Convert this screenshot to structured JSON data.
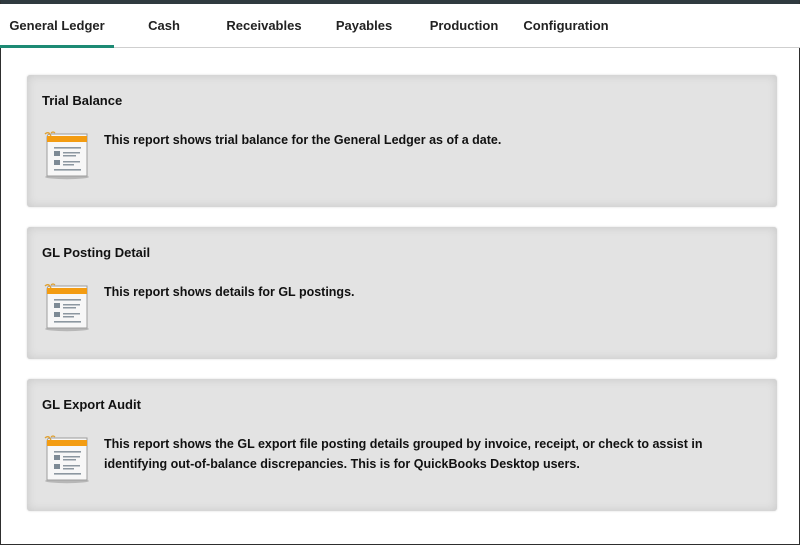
{
  "tabs": [
    {
      "label": "General Ledger",
      "active": true
    },
    {
      "label": "Cash"
    },
    {
      "label": "Receivables"
    },
    {
      "label": "Payables"
    },
    {
      "label": "Production"
    },
    {
      "label": "Configuration"
    }
  ],
  "colors": {
    "accent": "#1d8a74",
    "card_bg": "#e3e3e3",
    "icon_orange": "#f39c12"
  },
  "reports": [
    {
      "title": "Trial Balance",
      "description": "This report shows trial balance for the General Ledger as of a date.",
      "icon": "report-document-icon"
    },
    {
      "title": "GL Posting Detail",
      "description": "This report shows details for GL postings.",
      "icon": "report-document-icon"
    },
    {
      "title": "GL Export Audit",
      "description": "This report shows the GL export file posting details grouped by invoice, receipt, or check to assist in identifying out-of-balance discrepancies. This is for QuickBooks Desktop users.",
      "icon": "report-document-icon"
    }
  ]
}
